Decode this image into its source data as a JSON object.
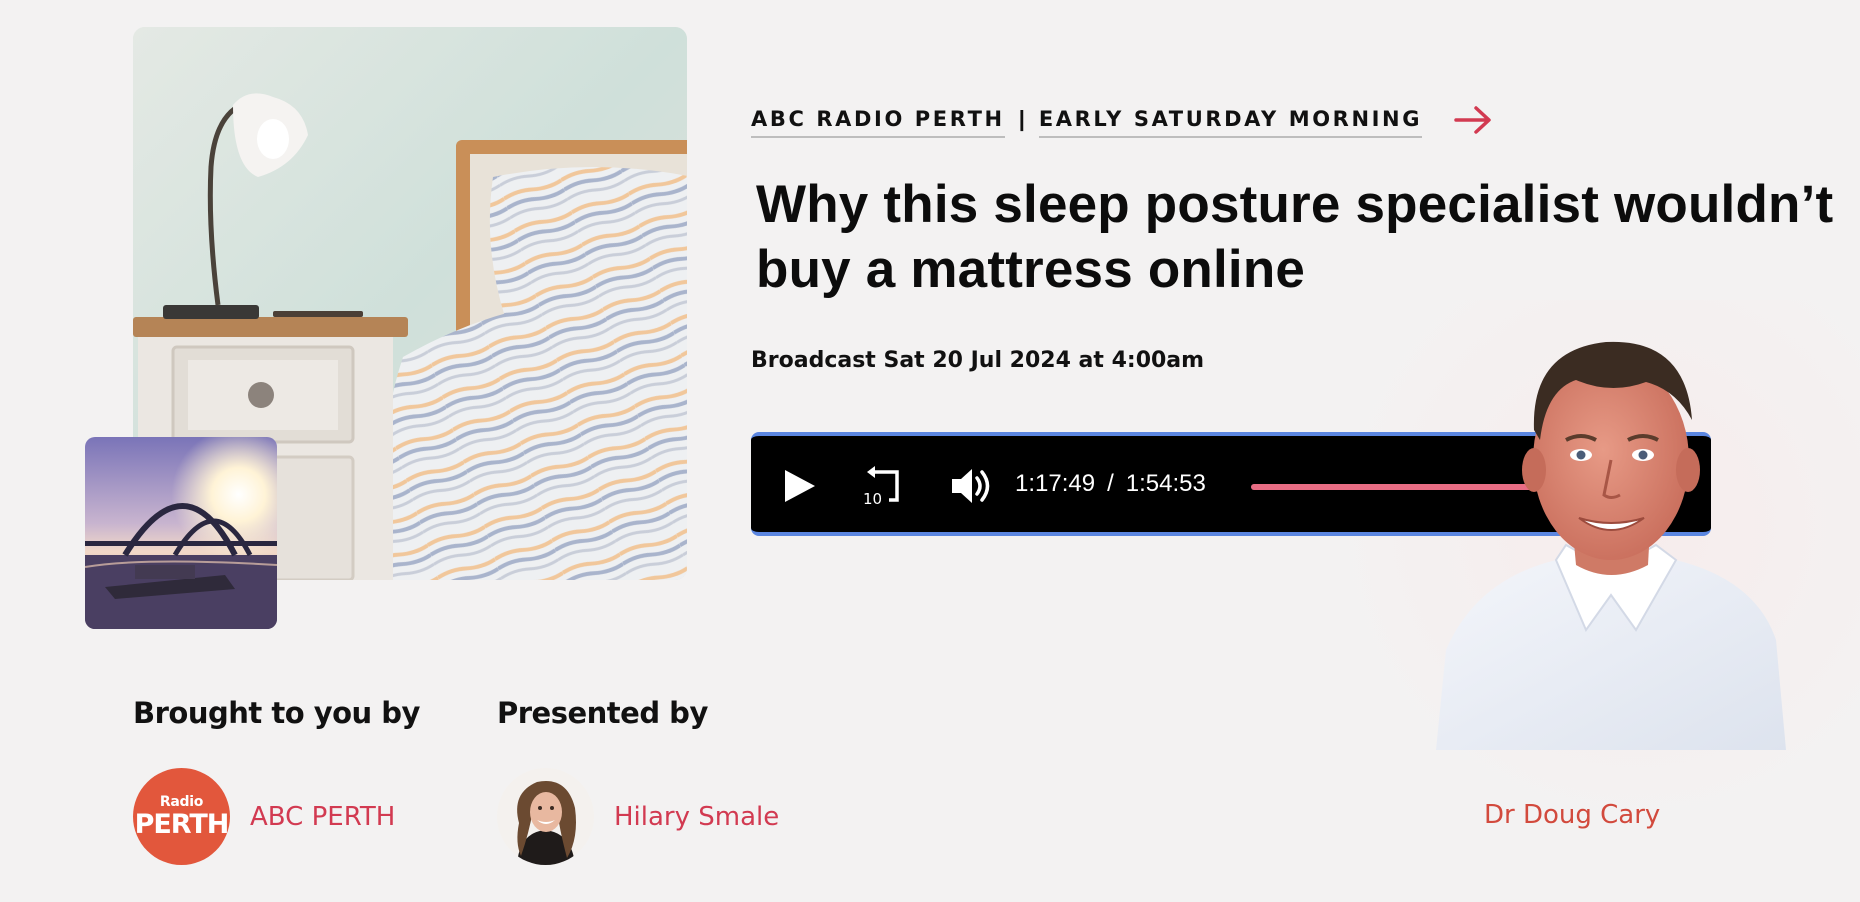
{
  "breadcrumbs": [
    {
      "label": "ABC RADIO PERTH"
    },
    {
      "label": "EARLY SATURDAY MORNING"
    }
  ],
  "breadcrumb_separator": "|",
  "title": "Why this sleep posture specialist wouldn’t buy a mattress online",
  "broadcast": "Broadcast Sat 20 Jul 2024 at 4:00am",
  "player": {
    "current_time": "1:17:49",
    "separator": "/",
    "duration": "1:54:53",
    "progress_fraction": 0.677
  },
  "credits": {
    "brought_heading": "Brought to you by",
    "presented_heading": "Presented by",
    "brand": {
      "name": "ABC PERTH",
      "logo_top": "Radio",
      "logo_bottom": "PERTH"
    },
    "host": {
      "name": "Hilary Smale"
    }
  },
  "guest": {
    "name": "Dr Doug Cary"
  },
  "colors": {
    "accent_red": "#d23a51",
    "player_border": "#5b86e0",
    "progress_fill": "#e86d84",
    "logo_orange": "#e2573c"
  },
  "icons": {
    "breadcrumb_arrow": "arrow-right-icon",
    "play": "play-icon",
    "rewind": "rewind-10-icon",
    "volume": "volume-icon"
  }
}
